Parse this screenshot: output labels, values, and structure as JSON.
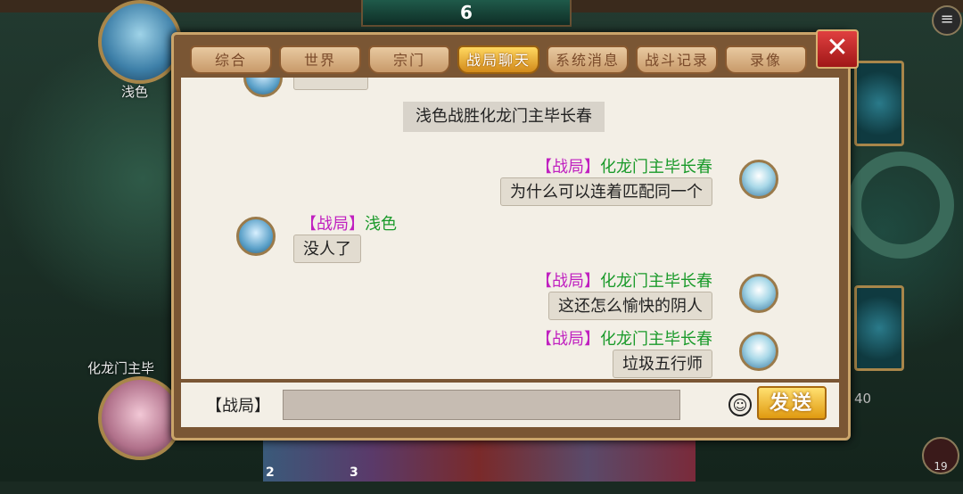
{
  "game": {
    "top_card_count": "6",
    "menu_icon": "menu-icon",
    "player_top_name": "浅色",
    "player_bottom_name": "化龙门主毕",
    "timer_text": "40",
    "corner_count": "19",
    "bottom_card_numbers": [
      "2",
      "3"
    ]
  },
  "dialog": {
    "tabs": [
      {
        "label": "综合",
        "active": false
      },
      {
        "label": "世界",
        "active": false
      },
      {
        "label": "宗门",
        "active": false
      },
      {
        "label": "战局聊天",
        "active": true
      },
      {
        "label": "系统消息",
        "active": false
      },
      {
        "label": "战斗记录",
        "active": false
      },
      {
        "label": "录像",
        "active": false
      }
    ],
    "close_label": "✕"
  },
  "chat": {
    "system_message": "浅色战胜化龙门主毕长春",
    "messages": [
      {
        "tag": "【战局】",
        "sender": "化龙门主毕长春",
        "text": "为什么可以连着匹配同一个",
        "side": "right"
      },
      {
        "tag": "【战局】",
        "sender": "浅色",
        "text": "没人了",
        "side": "left"
      },
      {
        "tag": "【战局】",
        "sender": "化龙门主毕长春",
        "text": "这还怎么愉快的阴人",
        "side": "right"
      },
      {
        "tag": "【战局】",
        "sender": "化龙门主毕长春",
        "text": "垃圾五行师",
        "side": "right"
      }
    ]
  },
  "input": {
    "channel_label": "【战局】",
    "value": "",
    "emoji_icon": "smiley-icon",
    "send_label": "发送"
  },
  "colors": {
    "tag": "#c020c0",
    "sender_name": "#1a9a2a",
    "active_tab": "#f0b030",
    "close": "#c02020"
  }
}
